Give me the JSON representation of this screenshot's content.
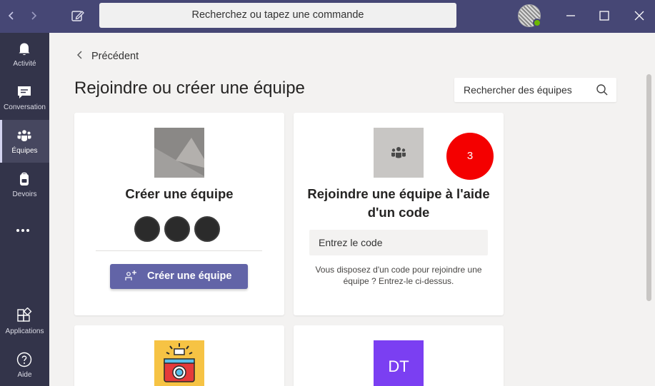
{
  "titlebar": {
    "search_placeholder": "Recherchez ou tapez une commande",
    "back_icon": "chevron-left-icon",
    "forward_icon": "chevron-right-icon",
    "compose_icon": "compose-icon",
    "presence_status": "available",
    "window_controls": [
      "minimize-icon",
      "maximize-icon",
      "close-icon"
    ]
  },
  "rail": {
    "items": [
      {
        "label": "Activité",
        "icon": "bell-icon"
      },
      {
        "label": "Conversation",
        "icon": "chat-icon"
      },
      {
        "label": "Équipes",
        "icon": "teams-icon",
        "active": true
      },
      {
        "label": "Devoirs",
        "icon": "backpack-icon"
      },
      {
        "label": "",
        "icon": "more-icon"
      },
      {
        "label": "Applications",
        "icon": "apps-icon"
      },
      {
        "label": "Aide",
        "icon": "help-icon"
      }
    ]
  },
  "main": {
    "back_label": "Précédent",
    "title": "Rejoindre ou créer une équipe",
    "team_search_placeholder": "Rechercher des équipes"
  },
  "create_card": {
    "title": "Créer une équipe",
    "button_label": "Créer une équipe"
  },
  "join_card": {
    "title": "Rejoindre une équipe à l'aide d'un code",
    "badge": "3",
    "code_placeholder": "Entrez le code",
    "hint": "Vous disposez d'un code pour rejoindre une équipe ? Entrez-le ci-dessus."
  },
  "lower_cards": {
    "right_tile_text": "DT"
  },
  "colors": {
    "titlebar": "#464775",
    "rail": "#33344a",
    "accent": "#6264a7",
    "badge": "#f40000",
    "presence": "#6bb700",
    "dt_tile": "#7b3ff2",
    "camera_tile": "#f6c344"
  }
}
